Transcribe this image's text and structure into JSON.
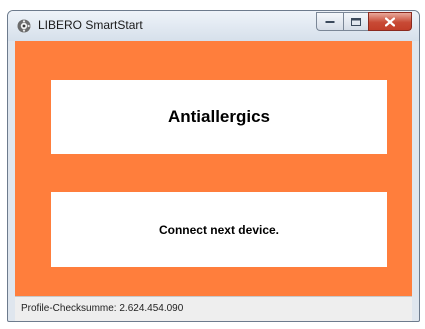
{
  "window": {
    "title": "LIBERO SmartStart",
    "icons": {
      "app": "libero-app-icon",
      "minimize": "minimize-icon",
      "maximize": "maximize-icon",
      "close": "close-icon"
    }
  },
  "main": {
    "background_color": "#ff7e3c",
    "profile_name": "Antiallergics",
    "message": "Connect next device."
  },
  "statusbar": {
    "text": "Profile-Checksumme: 2.624.454.090"
  }
}
